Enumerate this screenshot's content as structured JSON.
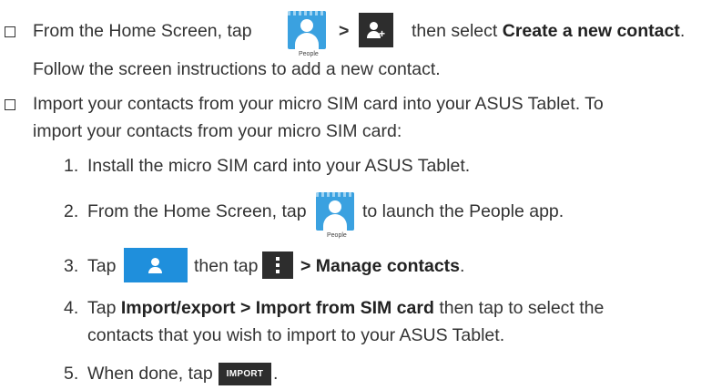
{
  "bullet1": {
    "prefix": "From the Home Screen, tap",
    "sep": ">",
    "middle": "then select",
    "bold": "Create a new contact",
    "end": ".",
    "sub": "Follow the screen instructions to add a new contact."
  },
  "people_caption": "People",
  "bullet2": {
    "line1": "Import your contacts from your micro SIM card into your ASUS Tablet. To",
    "line2": "import your contacts from your micro SIM card:"
  },
  "steps": {
    "s1": {
      "num": "1.",
      "text": "Install the micro SIM card into your ASUS Tablet."
    },
    "s2": {
      "num": "2.",
      "prefix": "From the Home Screen, tap",
      "suffix": "to launch the People app."
    },
    "s3": {
      "num": "3.",
      "prefix": "Tap",
      "middle": "then tap",
      "bold": "> Manage contacts",
      "end": "."
    },
    "s4": {
      "num": "4.",
      "prefix": "Tap",
      "bold": "Import/export > Import from SIM card",
      "suffix": "then tap to select the",
      "line2": "contacts that you wish to import to your ASUS Tablet."
    },
    "s5": {
      "num": "5.",
      "prefix": "When done, tap",
      "end": "."
    }
  },
  "import_label": "IMPORT",
  "colors": {
    "people_blue": "#3aa1e0",
    "tab_blue": "#1f8fdc",
    "dark": "#2d2d2d"
  }
}
